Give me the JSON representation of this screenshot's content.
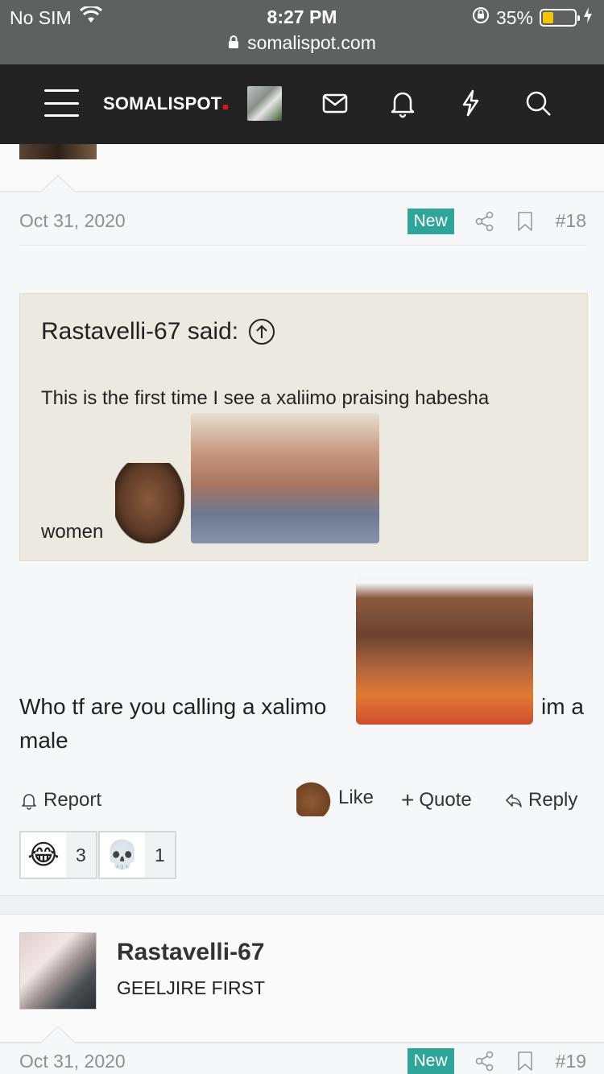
{
  "status_bar": {
    "carrier": "No SIM",
    "time": "8:27 PM",
    "battery_percent": "35%",
    "battery_level": 0.35,
    "url": "somalispot.com"
  },
  "navbar": {
    "logo": "SOMALISPOT",
    "icons": [
      "menu-icon",
      "mail-icon",
      "bell-icon",
      "lightning-icon",
      "search-icon"
    ]
  },
  "post18": {
    "date": "Oct 31, 2020",
    "badge": "New",
    "number": "#18",
    "quote": {
      "author_line": "Rastavelli-67 said:",
      "text_line1": "This is the first time I see a xaliimo praising habesha",
      "text_line2": "women"
    },
    "body_line1": "Who tf are you calling a xalimo",
    "body_tail": "im a",
    "body_line2": "male",
    "actions": {
      "report": "Report",
      "like": "Like",
      "quote": "Quote",
      "reply": "Reply"
    },
    "reactions": [
      {
        "emoji": "😂",
        "count": "3"
      },
      {
        "emoji": "💀",
        "count": "1"
      }
    ]
  },
  "next_post": {
    "username": "Rastavelli-67",
    "user_title": "GEELJIRE FIRST",
    "date": "Oct 31, 2020",
    "badge": "New",
    "number": "#19"
  },
  "colors": {
    "badge": "#2fa59a",
    "navbar": "#232323",
    "status_bar": "#5f6060",
    "quote_bg": "#ebe9e0"
  }
}
